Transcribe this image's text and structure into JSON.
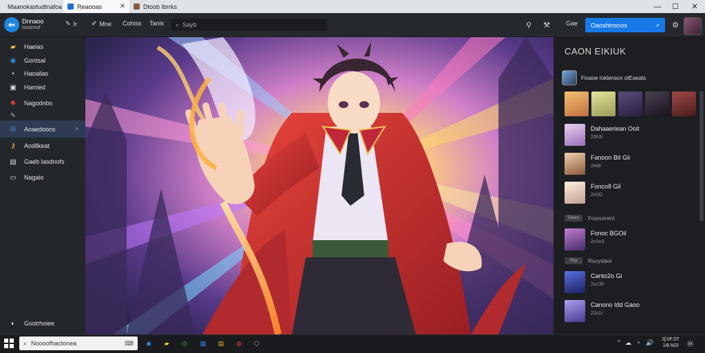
{
  "tabs": [
    {
      "label": "Maanokastudtnafoa",
      "color": "#e0a33a"
    },
    {
      "label": "Reaooas",
      "color": "#1e6fd9"
    },
    {
      "label": "Dtoob Ibrrks",
      "color": "#8a5a3a"
    }
  ],
  "window_controls": [
    "—",
    "☐",
    "✕"
  ],
  "header": {
    "brand_title": "Dnnaoo",
    "brand_subtitle": "Isosnnof",
    "tools": [
      {
        "icon": "pen-icon",
        "label": "Ir"
      },
      {
        "icon": "brush-icon",
        "label": "Mne"
      },
      {
        "label": "Cohiss"
      },
      {
        "label": "Tanis"
      }
    ],
    "search_placeholder": "Sayb",
    "login_label": "Gae",
    "primary_button": "Oaoshtnsnos"
  },
  "sidebar": {
    "items": [
      {
        "icon": "folder-icon",
        "label": "Haeias",
        "color": "#f0c040"
      },
      {
        "icon": "edge-icon",
        "label": "Gontsal",
        "color": "#2a8ee8"
      },
      {
        "icon": "dot-icon",
        "label": "Haoailas",
        "color": "#ccc"
      },
      {
        "icon": "window-icon",
        "label": "Hamied",
        "color": "#ddd"
      },
      {
        "icon": "puzzle-icon",
        "label": "Nagodnbs",
        "color": "#e0443a"
      },
      {
        "icon": "pen-icon",
        "label": "",
        "color": "#aaa"
      },
      {
        "icon": "circle-icon",
        "label": "Aoaedoons",
        "color": "#5aa0f0",
        "active": true
      },
      {
        "icon": "key-icon",
        "label": "Aodllkeat",
        "color": "#f0c040"
      },
      {
        "icon": "doc-icon",
        "label": "Gaeb Iasdnofs",
        "color": "#ddd"
      },
      {
        "icon": "frame-icon",
        "label": "Nagaio",
        "color": "#ddd"
      }
    ],
    "footer_label": "Gsotrhoiee"
  },
  "panel": {
    "title": "CAON EIKIUK",
    "featured_label": "Fioaoe Ioklenscn otEaeats",
    "strip_colors": [
      "#e8a34a",
      "#c7c77a",
      "#4a3a5a",
      "#3a3040",
      "#7a3a3a"
    ],
    "list": [
      {
        "name": "Dahaaeriean Ooit",
        "meta": "2063l",
        "thumb": "#c9a7d8"
      },
      {
        "name": "Fanoon Bit Gii",
        "meta": "2ei8l",
        "thumb": "#d8b090"
      },
      {
        "name": "Fonco8 Gil",
        "meta": "2ol32",
        "thumb": "#e0d0c0"
      },
      {
        "tag": "Fosnurrent",
        "chip": "Dtoen"
      },
      {
        "name": "Fonoc BGOil",
        "meta": "2o1o3",
        "thumb": "#8a5a9a"
      },
      {
        "tag": "Rsoyslaoi",
        "chip": "Ooy"
      },
      {
        "name": "Canto2o Gi",
        "meta": "2o130",
        "thumb": "#3a4aa0"
      },
      {
        "name": "Canono Idd Gaoo",
        "meta": "22o1i",
        "thumb": "#7a70c0"
      }
    ]
  },
  "taskbar": {
    "search_placeholder": "Noooofhactonea",
    "apps": [
      {
        "icon": "edge-icon",
        "color": "#2a8ee8"
      },
      {
        "icon": "folder-icon",
        "color": "#e8c040"
      },
      {
        "icon": "chrome-icon",
        "color": "#4caf50"
      },
      {
        "icon": "store-icon",
        "color": "#2a7ae8"
      },
      {
        "icon": "explorer-icon",
        "color": "#f0b030"
      },
      {
        "icon": "opera-icon",
        "color": "#e04040"
      },
      {
        "icon": "app-icon",
        "color": "#aaa"
      }
    ],
    "tray": [
      "⌃",
      "☁",
      "◔",
      "🔊",
      "Ⓜ"
    ],
    "time": "2ʃ:0F:0T",
    "date": "1i8 M2l"
  }
}
